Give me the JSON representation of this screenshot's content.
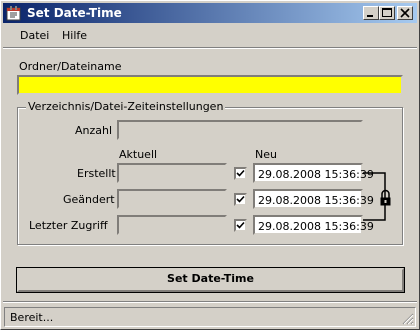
{
  "window": {
    "title": "Set Date-Time"
  },
  "menu": {
    "items": [
      "Datei",
      "Hilfe"
    ]
  },
  "path_section": {
    "label": "Ordner/Dateiname",
    "value": ""
  },
  "settings_group": {
    "legend": "Verzeichnis/Datei-Zeiteinstellungen",
    "count_label": "Anzahl",
    "count_value": "",
    "col_current": "Aktuell",
    "col_new": "Neu",
    "rows": [
      {
        "label": "Erstellt",
        "current": "",
        "checked": true,
        "new": "29.08.2008 15:36:39"
      },
      {
        "label": "Geändert",
        "current": "",
        "checked": true,
        "new": "29.08.2008 15:36:39"
      },
      {
        "label": "Letzter Zugriff",
        "current": "",
        "checked": true,
        "new": "29.08.2008 15:36:39"
      }
    ]
  },
  "action": {
    "label": "Set Date-Time"
  },
  "status": {
    "text": "Bereit..."
  },
  "colors": {
    "title_start": "#0a246a",
    "title_end": "#a6caf0",
    "path_highlight": "#ffff00"
  },
  "icons": [
    "app-icon",
    "minimize-icon",
    "maximize-icon",
    "close-icon",
    "checkmark-icon",
    "lock-icon",
    "size-grip-icon"
  ]
}
